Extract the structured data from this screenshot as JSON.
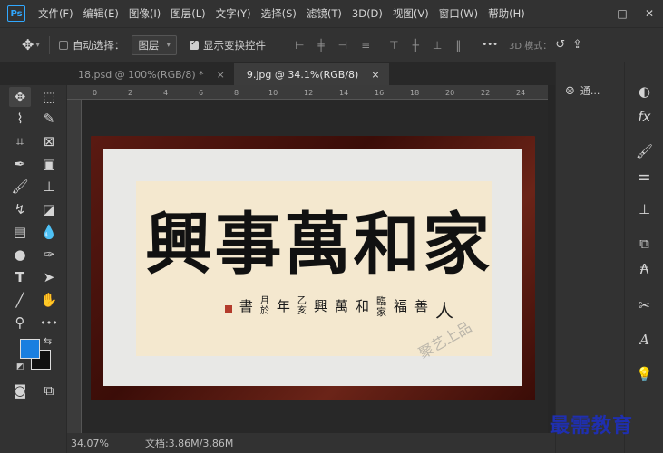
{
  "app": {
    "logo": "Ps"
  },
  "menu": [
    "文件(F)",
    "编辑(E)",
    "图像(I)",
    "图层(L)",
    "文字(Y)",
    "选择(S)",
    "滤镜(T)",
    "3D(D)",
    "视图(V)",
    "窗口(W)",
    "帮助(H)"
  ],
  "window_controls": {
    "minimize": "—",
    "restore": "□",
    "close": "✕"
  },
  "options": {
    "auto_select_label": "自动选择：",
    "layer_select_value": "图层",
    "show_transform_label": "显示变换控件",
    "more": "•••",
    "mode_3d": "3D 模式："
  },
  "tabs": [
    {
      "label": "18.psd @ 100%(RGB/8) *",
      "close": "×"
    },
    {
      "label": "9.jpg @ 34.1%(RGB/8)",
      "close": "×"
    }
  ],
  "ruler": {
    "ticks": [
      "0",
      "2",
      "4",
      "6",
      "8",
      "10",
      "12",
      "14",
      "16",
      "18",
      "20",
      "22",
      "24"
    ]
  },
  "artwork": {
    "main_text": [
      "家",
      "和",
      "萬",
      "事",
      "興"
    ],
    "inscription": [
      "人",
      "善",
      "福",
      "臨",
      "家",
      "和",
      "萬",
      "興",
      "乙",
      "亥",
      "年",
      "月",
      "於",
      "書"
    ],
    "watermark": "聚艺上品"
  },
  "panels": {
    "channels_label": "通..."
  },
  "status": {
    "zoom": "34.07%",
    "doc_size": "文档:3.86M/3.86M"
  },
  "brand": "最需教育",
  "colors": {
    "foreground": "#1a7fe0",
    "background": "#111111",
    "accent": "#31a8ff"
  }
}
